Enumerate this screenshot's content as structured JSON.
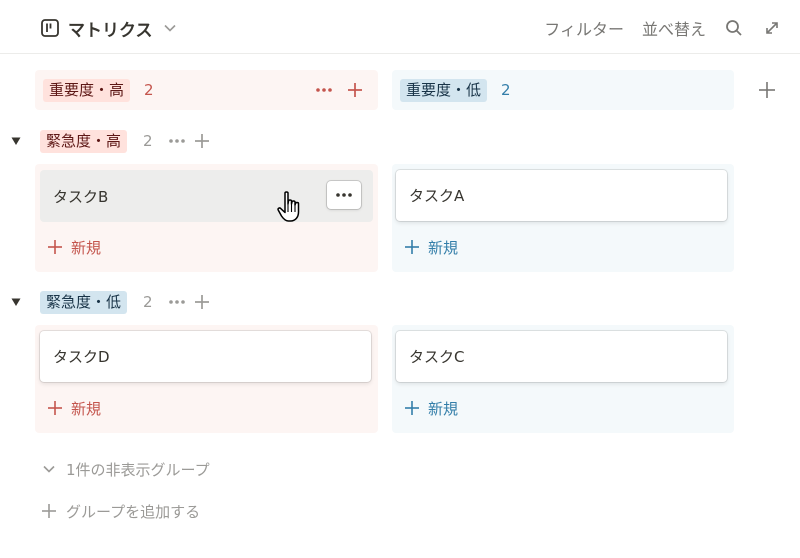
{
  "header": {
    "view_title": "マトリクス",
    "filter_label": "フィルター",
    "sort_label": "並べ替え",
    "icons": [
      "board-icon",
      "chevron-down-icon",
      "search-icon",
      "expand-icon"
    ]
  },
  "columns": [
    {
      "label": "重要度・高",
      "count": "2",
      "color": "red",
      "accent": "#c4554d"
    },
    {
      "label": "重要度・低",
      "count": "2",
      "color": "blue",
      "accent": "#337ea9"
    }
  ],
  "groups": [
    {
      "label": "緊急度・高",
      "count": "2",
      "color": "red",
      "cards": [
        "タスクB",
        "タスクA"
      ]
    },
    {
      "label": "緊急度・低",
      "count": "2",
      "color": "blue",
      "cards": [
        "タスクD",
        "タスクC"
      ]
    }
  ],
  "new_label": "新規",
  "footer": {
    "hidden_groups": "1件の非表示グループ",
    "add_group": "グループを追加する"
  }
}
